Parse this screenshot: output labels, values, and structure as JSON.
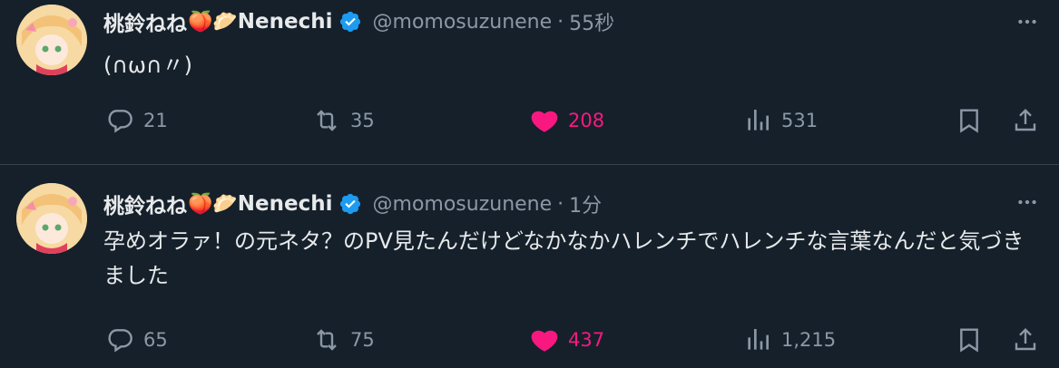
{
  "tweets": [
    {
      "display_name": "桃鈴ねね",
      "emojis": "🍑🥟",
      "name_suffix": "Nenechi",
      "handle": "@momosuzunene",
      "separator": "·",
      "time": "55秒",
      "text": "(∩ω∩〃)",
      "replies": "21",
      "retweets": "35",
      "likes": "208",
      "views": "531"
    },
    {
      "display_name": "桃鈴ねね",
      "emojis": "🍑🥟",
      "name_suffix": "Nenechi",
      "handle": "@momosuzunene",
      "separator": "·",
      "time": "1分",
      "text": "孕めオラァ！の元ネタ？のPV見たんだけどなかなかハレンチでハレンチな言葉なんだと気づきました",
      "replies": "65",
      "retweets": "75",
      "likes": "437",
      "views": "1,215"
    }
  ],
  "colors": {
    "background": "#15202b",
    "text": "#e7e9ea",
    "muted": "#8b98a5",
    "like": "#f91880",
    "verified": "#1d9bf0",
    "divider": "#38444d"
  }
}
